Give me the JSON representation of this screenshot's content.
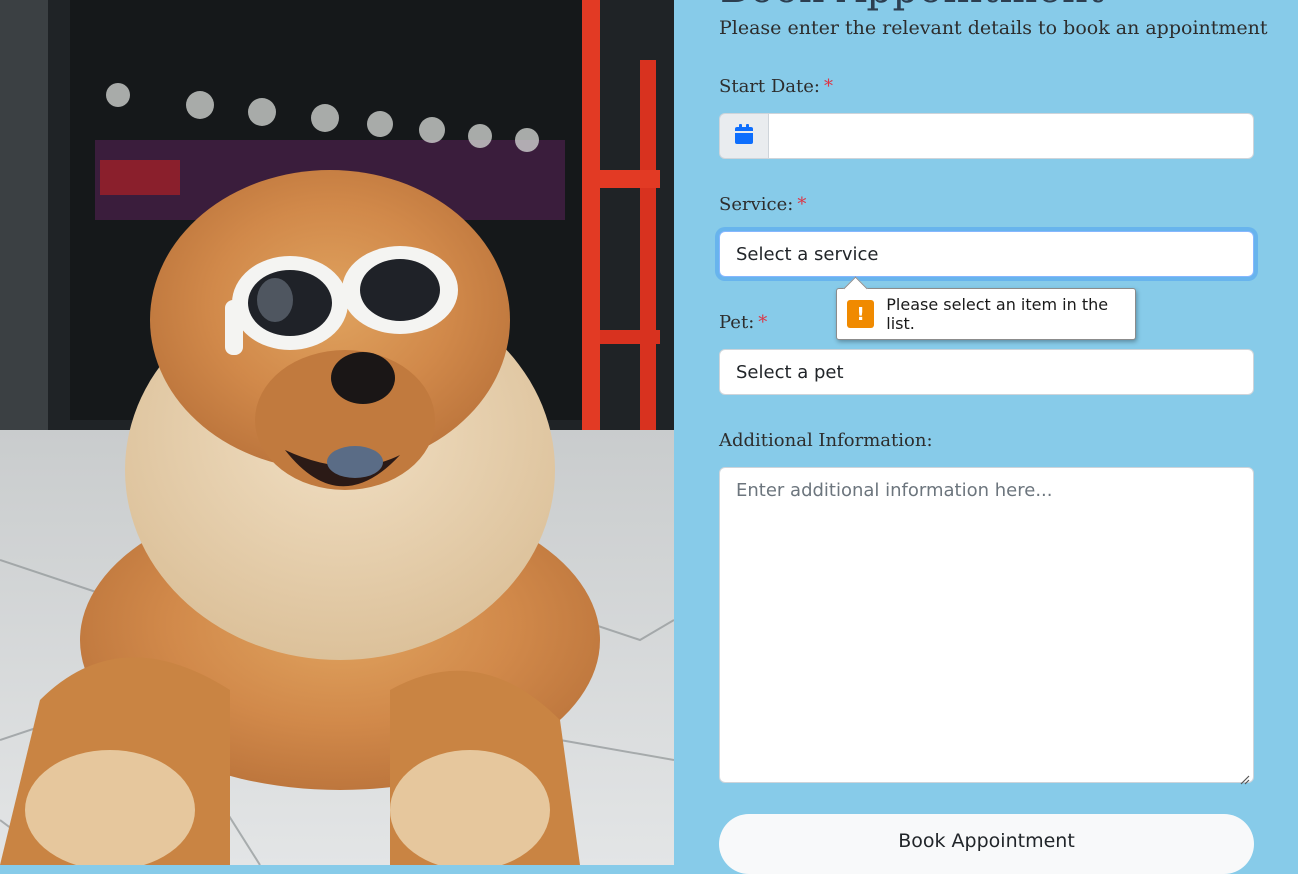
{
  "form": {
    "heading_partial": "Book Appointment",
    "subtitle": "Please enter the relevant details to book an appointment",
    "start_date": {
      "label": "Start Date:",
      "required_mark": "*",
      "value": ""
    },
    "service": {
      "label": "Service:",
      "required_mark": "*",
      "selected": "Select a service"
    },
    "pet": {
      "label": "Pet:",
      "required_mark": "*",
      "selected": "Select a pet"
    },
    "additional": {
      "label": "Additional Information:",
      "placeholder": "Enter additional information here..."
    },
    "submit_label": "Book Appointment"
  },
  "tooltip": {
    "icon": "warning-icon",
    "text": "Please select an item in the list."
  },
  "colors": {
    "panel_bg": "#87cbe9",
    "required": "#dc3545",
    "calendar_icon": "#0d6efd",
    "warning": "#f08a00",
    "focus_ring": "#86b7fe"
  }
}
